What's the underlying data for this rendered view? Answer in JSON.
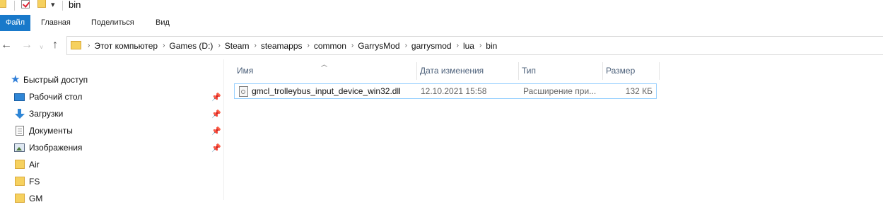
{
  "window": {
    "title": "bin"
  },
  "ribbon": {
    "tabs": [
      {
        "label": "Файл"
      },
      {
        "label": "Главная"
      },
      {
        "label": "Поделиться"
      },
      {
        "label": "Вид"
      }
    ]
  },
  "nav_buttons": {
    "back": "←",
    "forward": "→",
    "up": "↑"
  },
  "address": {
    "crumbs": [
      "Этот компьютер",
      "Games (D:)",
      "Steam",
      "steamapps",
      "common",
      "GarrysMod",
      "garrysmod",
      "lua",
      "bin"
    ]
  },
  "nav_pane": {
    "quick_access": "Быстрый доступ",
    "items": [
      {
        "label": "Рабочий стол",
        "icon": "desktop-icon",
        "pinned": true
      },
      {
        "label": "Загрузки",
        "icon": "downloads-icon",
        "pinned": true
      },
      {
        "label": "Документы",
        "icon": "documents-icon",
        "pinned": true
      },
      {
        "label": "Изображения",
        "icon": "pictures-icon",
        "pinned": true
      },
      {
        "label": "Air",
        "icon": "folder-icon",
        "pinned": false
      },
      {
        "label": "FS",
        "icon": "folder-icon",
        "pinned": false
      },
      {
        "label": "GM",
        "icon": "folder-icon",
        "pinned": false
      }
    ]
  },
  "columns": {
    "name": "Имя",
    "date": "Дата изменения",
    "type": "Тип",
    "size": "Размер"
  },
  "files": [
    {
      "name": "gmcl_trolleybus_input_device_win32.dll",
      "date": "12.10.2021 15:58",
      "type": "Расширение при...",
      "size": "132 КБ",
      "icon": "dll-file-icon"
    }
  ],
  "colors": {
    "file_tab": "#1979ca",
    "selection_border": "#99d1ff",
    "folder": "#f6d15f",
    "header_text": "#4c607a"
  }
}
